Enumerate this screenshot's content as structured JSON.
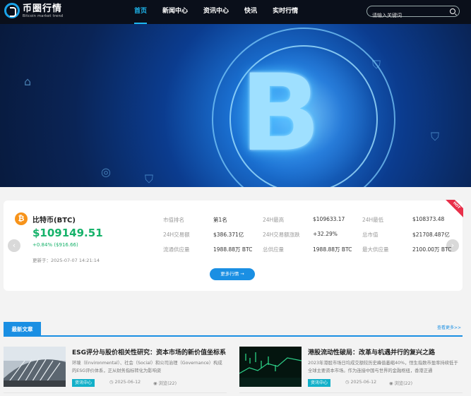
{
  "brand": {
    "title": "币圈行情",
    "subtitle": "Bitcoin market trend"
  },
  "nav": {
    "items": [
      "首页",
      "新闻中心",
      "资讯中心",
      "快讯",
      "实时行情"
    ],
    "active": 0
  },
  "search": {
    "placeholder": "请输入关键词"
  },
  "ticker": {
    "name": "比特币(BTC)",
    "price": "$109149.51",
    "change": "+0.84% ($916.66)",
    "updated": "更新于：2025-07-07 14:21:14",
    "hot_badge": "HOT",
    "more_button": "更多行情 →",
    "stats": [
      {
        "label": "市值排名",
        "value": "第1名"
      },
      {
        "label": "24H最高",
        "value": "$109633.17"
      },
      {
        "label": "24H最低",
        "value": "$108373.48"
      },
      {
        "label": "24H交易额",
        "value": "$386.371亿"
      },
      {
        "label": "24H交易额涨跌",
        "value": "+32.29%"
      },
      {
        "label": "总市值",
        "value": "$21708.487亿"
      },
      {
        "label": "流通供应量",
        "value": "1988.88万 BTC"
      },
      {
        "label": "总供应量",
        "value": "1988.88万 BTC"
      },
      {
        "label": "最大供应量",
        "value": "2100.00万 BTC"
      }
    ]
  },
  "latest": {
    "tab": "最新文章",
    "more": "查看更多>>",
    "articles": [
      {
        "title": "ESG评分与股价相关性研究：资本市场的新价值坐标系",
        "desc": "环境（Environmental）、社会（Social）和公司治理（Governance）构成的ESG评价体系，正从财务指标转化为影响资",
        "tag": "资讯中心",
        "date": "2025-06-12",
        "views": "浏览(22)"
      },
      {
        "title": "港股流动性破局：改革与机遇并行的复兴之路",
        "desc": "2023年港股市场日均成交额较历史峰值萎缩40%，恒生指数市盈率持续低于全球主要资本市场。作为连接中国与世界的金融枢纽，香港正通",
        "tag": "资讯中心",
        "date": "2025-06-12",
        "views": "浏览(22)"
      }
    ]
  }
}
